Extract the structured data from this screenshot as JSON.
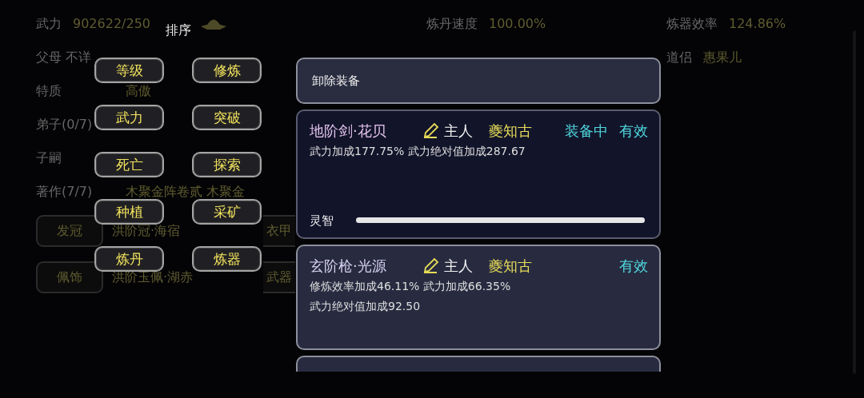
{
  "profile": {
    "rows": [
      {
        "label": "武力",
        "value": "902622/250",
        "icon": true
      },
      {
        "label": "父母 不详"
      },
      {
        "label": "特质",
        "value": "高傲"
      },
      {
        "label": "弟子(0/7)"
      },
      {
        "label": "子嗣"
      },
      {
        "label": "著作(7/7)",
        "value": "木聚金阵卷贰 木聚金"
      }
    ],
    "slots": [
      {
        "slot": "发冠",
        "item": "洪阶冠·海宿",
        "slot2": "衣甲"
      },
      {
        "slot": "佩饰",
        "item": "洪阶玉佩·湖赤",
        "slot2": "武器"
      }
    ],
    "middle": [
      {
        "label": "炼丹速度",
        "value": "100.00%"
      }
    ],
    "right": [
      {
        "label": "炼器效率",
        "value": "124.86%"
      },
      {
        "label": "道侣",
        "value": "惠果儿"
      }
    ]
  },
  "sort": {
    "title": "排序",
    "options": [
      "等级",
      "修炼",
      "武力",
      "突破",
      "死亡",
      "探索",
      "种植",
      "采矿",
      "炼丹",
      "炼器"
    ]
  },
  "equipment": {
    "unequip": "卸除装备",
    "items": [
      {
        "name": "地阶剑·花贝",
        "color": "#e4c4ee",
        "owner_label": "主人",
        "owner": "夔知古",
        "status": "装备中",
        "validity": "有效",
        "selected": true,
        "effects": [
          "武力加成177.75% 武力绝对值加成287.67"
        ],
        "stat": {
          "label": "灵智",
          "level": 1.0
        }
      },
      {
        "name": "玄阶枪·光源",
        "color": "#d8d2f2",
        "owner_label": "主人",
        "owner": "夔知古",
        "validity": "有效",
        "selected": false,
        "effects": [
          "修炼效率加成46.11% 武力加成66.35%",
          "武力绝对值加成92.50"
        ]
      }
    ]
  }
}
